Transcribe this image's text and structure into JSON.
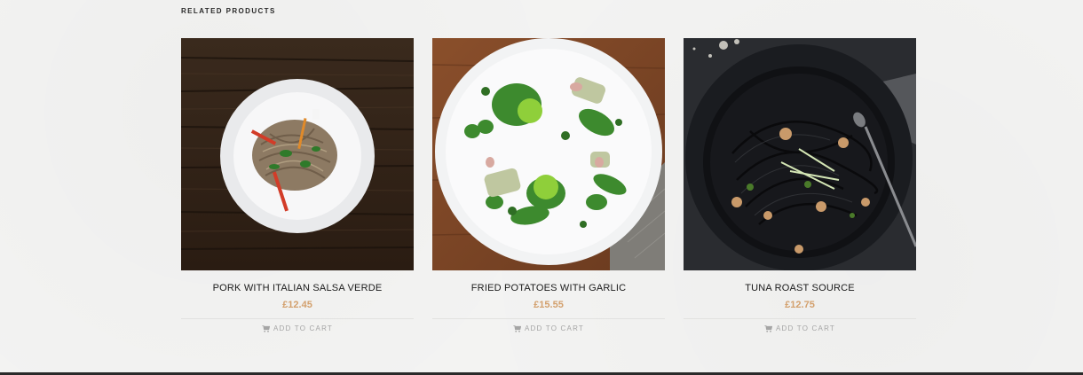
{
  "related": {
    "title": "RELATED PRODUCTS",
    "products": [
      {
        "name": "PORK WITH ITALIAN SALSA VERDE",
        "price": "£12.45",
        "cart_label": "ADD TO CART",
        "image_icon": "noodle-plate-photo"
      },
      {
        "name": "FRIED POTATOES WITH GARLIC",
        "price": "£15.55",
        "cart_label": "ADD TO CART",
        "image_icon": "greens-plate-photo"
      },
      {
        "name": "TUNA ROAST SOURCE",
        "price": "£12.75",
        "cart_label": "ADD TO CART",
        "image_icon": "black-pasta-bowl-photo"
      }
    ]
  },
  "colors": {
    "price": "#d3a06d",
    "cart_text": "#a5a5a5",
    "name_text": "#1b1b1b",
    "footer": "#2a2a2a"
  }
}
